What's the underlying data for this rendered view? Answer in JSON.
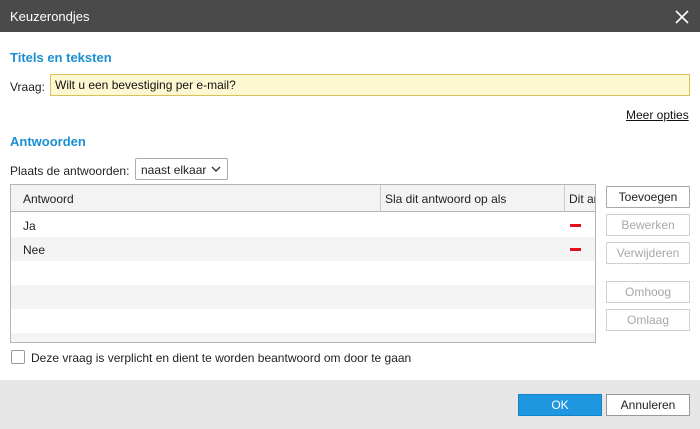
{
  "window": {
    "title": "Keuzerondjes",
    "close_icon": "close-icon"
  },
  "titles_section": {
    "heading": "Titels en teksten",
    "question_label": "Vraag:",
    "question_value": "Wilt u een bevestiging per e-mail?",
    "more_options": "Meer opties"
  },
  "answers_section": {
    "heading": "Antwoorden",
    "placement_label": "Plaats de antwoorden:",
    "placement_value": "naast elkaar",
    "columns": [
      "Antwoord",
      "Sla dit antwoord op als",
      "Dit antwoord"
    ],
    "rows": [
      {
        "answer": "Ja",
        "save_as": "",
        "remove_icon": "minus-icon"
      },
      {
        "answer": "Nee",
        "save_as": "",
        "remove_icon": "minus-icon"
      }
    ],
    "buttons": {
      "add": "Toevoegen",
      "edit": "Bewerken",
      "delete": "Verwijderen",
      "up": "Omhoog",
      "down": "Omlaag"
    }
  },
  "required_checkbox": {
    "label": "Deze vraag is verplicht en dient te worden beantwoord om door te gaan",
    "checked": false
  },
  "footer": {
    "ok": "OK",
    "cancel": "Annuleren"
  },
  "colors": {
    "accent": "#1a8fd1",
    "titlebar": "#4a4a4a",
    "ok_button": "#1e97e0",
    "remove": "#e0101d",
    "input_bg": "#fdf8d1"
  }
}
